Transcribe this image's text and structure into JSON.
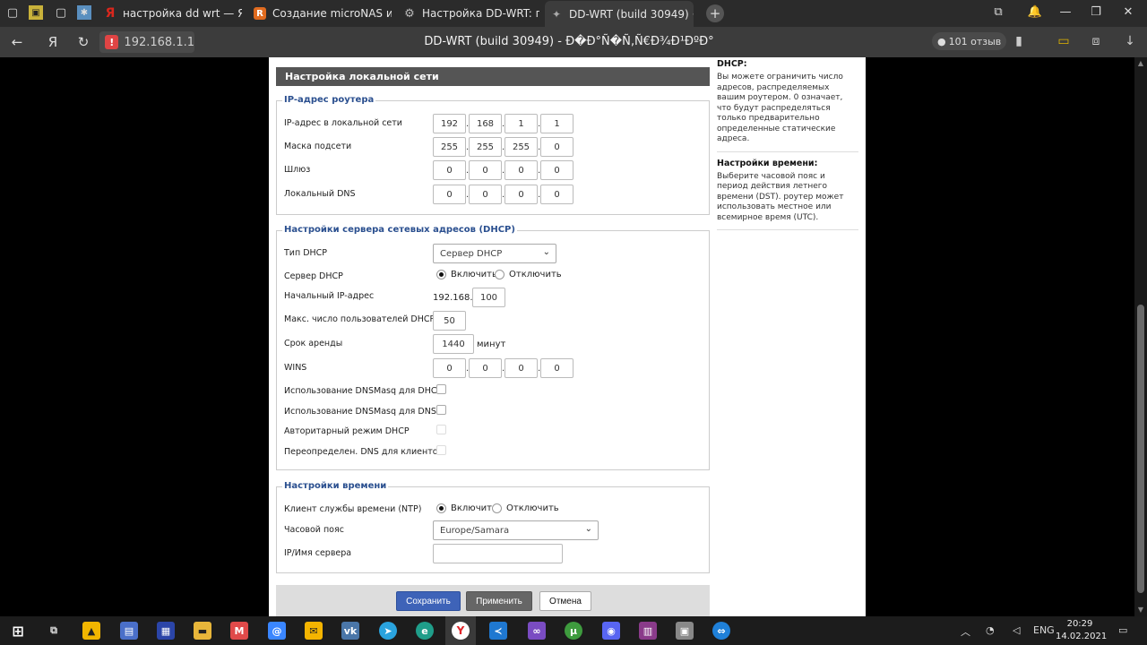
{
  "browser": {
    "tabs": [
      {
        "label": "настройка dd wrt — Яндекс",
        "fav": "Я",
        "color": "#d9271d"
      },
      {
        "label": "Создание microNAS из ро",
        "fav": "R",
        "color": "#e06b1f"
      },
      {
        "label": "Настройка DD-WRT: пошаг",
        "fav": "⚙",
        "color": "#5d6b7a"
      },
      {
        "label": "DD-WRT (build 30949) ·",
        "fav": "✦",
        "color": "#777777"
      }
    ],
    "new_tab": "+",
    "url": "192.168.1.1",
    "title": "DD-WRT (build 30949) - Ð�Ð°Ñ�Ñ‚Ñ€Ð¾Ð¹ÐºÐ°",
    "reviews": "101 отзыв"
  },
  "page": {
    "section_title": "Настройка локальной сети",
    "router_ip": {
      "legend": "IP-адрес роутера",
      "rows": [
        {
          "label": "IP-адрес в локальной сети",
          "octets": [
            "192",
            "168",
            "1",
            "1"
          ]
        },
        {
          "label": "Маска подсети",
          "octets": [
            "255",
            "255",
            "255",
            "0"
          ]
        },
        {
          "label": "Шлюз",
          "octets": [
            "0",
            "0",
            "0",
            "0"
          ]
        },
        {
          "label": "Локальный DNS",
          "octets": [
            "0",
            "0",
            "0",
            "0"
          ]
        }
      ]
    },
    "dhcp": {
      "legend": "Настройки сервера сетевых адресов (DHCP)",
      "type_label": "Тип DHCP",
      "type_value": "Сервер DHCP",
      "server_label": "Сервер DHCP",
      "enable": "Включить",
      "disable": "Отключить",
      "start_label": "Начальный IP-адрес",
      "start_prefix": "192.168.1.",
      "start_value": "100",
      "max_label": "Макс. число пользователей DHCP",
      "max_value": "50",
      "lease_label": "Срок аренды",
      "lease_value": "1440",
      "lease_unit": "минут",
      "wins_label": "WINS",
      "wins_octets": [
        "0",
        "0",
        "0",
        "0"
      ],
      "checks": [
        "Использование DNSMasq для DHCP",
        "Использование DNSMasq для DNS",
        "Авторитарный режим DHCP",
        "Переопределен. DNS для клиентов"
      ]
    },
    "time": {
      "legend": "Настройки времени",
      "ntp_label": "Клиент службы времени (NTP)",
      "enable": "Включить",
      "disable": "Отключить",
      "tz_label": "Часовой пояс",
      "tz_value": "Europe/Samara",
      "server_label": "IP/Имя сервера",
      "server_value": ""
    },
    "buttons": {
      "save": "Сохранить",
      "apply": "Применить",
      "cancel": "Отмена"
    },
    "help": {
      "dhcp_title": "DHCP:",
      "dhcp_text": "Вы можете ограничить число адресов, распределяемых вашим роутером. 0 означает, что будут распределяться только предварительно определенные статические адреса.",
      "time_title": "Настройки времени:",
      "time_text": "Выберите часовой пояс и период действия летнего времени (DST). роутер может использовать местное или всемирное время (UTC)."
    }
  },
  "taskbar": {
    "lang": "ENG",
    "time": "20:29",
    "date": "14.02.2021"
  }
}
